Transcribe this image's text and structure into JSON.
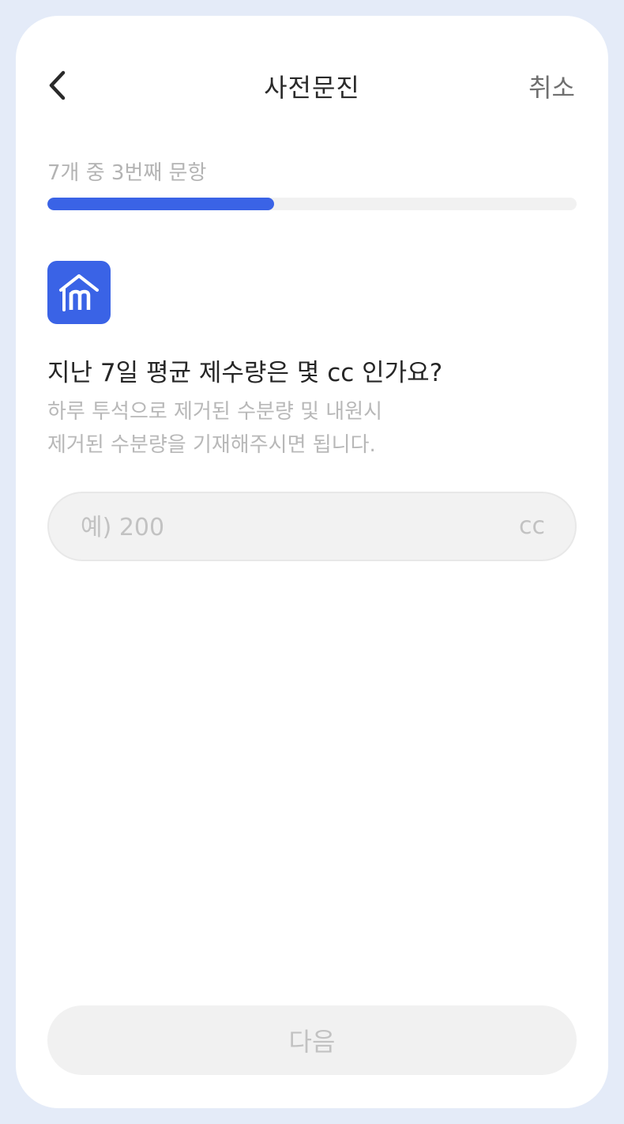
{
  "header": {
    "title": "사전문진",
    "cancel_label": "취소",
    "back_icon": "chevron-left-icon"
  },
  "progress": {
    "label": "7개 중 3번째 문항",
    "current": 3,
    "total": 7,
    "fill_color": "#3a63e6"
  },
  "question": {
    "icon": "home-m-logo-icon",
    "title": "지난 7일 평균 제수량은 몇 cc 인가요?",
    "helper_line1": "하루 투석으로 제거된 수분량 및 내원시",
    "helper_line2": "제거된 수분량을 기재해주시면 됩니다."
  },
  "input": {
    "value": "",
    "placeholder": "예) 200",
    "unit": "cc"
  },
  "footer": {
    "next_label": "다음"
  },
  "colors": {
    "accent": "#3a63e6",
    "frame": "#e4ebf8"
  }
}
